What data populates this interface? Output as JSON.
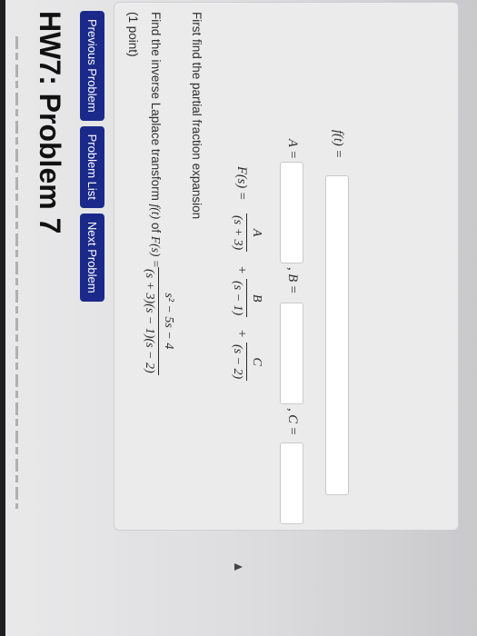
{
  "page_title": "HW7: Problem 7",
  "nav": {
    "previous": "Previous Problem",
    "list": "Problem List",
    "next": "Next Problem"
  },
  "problem": {
    "points": "(1 point)",
    "prompt_prefix": "Find the inverse Laplace transform ",
    "f_of_t": "f(t)",
    "prompt_of": " of ",
    "F_of_s": "F(s) =",
    "F_numerator": "s² − 5s − 4",
    "F_denominator": "(s + 3)(s − 1)(s − 2)",
    "partial_text": "First find the partial fraction expansion",
    "expansion": {
      "lhs": "F(s) =",
      "term_A_num": "A",
      "term_A_den": "(s + 3)",
      "plus_1": "+",
      "term_B_num": "B",
      "term_B_den": "(s − 1)",
      "plus_2": "+",
      "term_C_num": "C",
      "term_C_den": "(s − 2)"
    },
    "answers": {
      "A_label": "A =",
      "B_label": ", B =",
      "C_label": ", C =",
      "f_label": "f(t) ="
    }
  }
}
